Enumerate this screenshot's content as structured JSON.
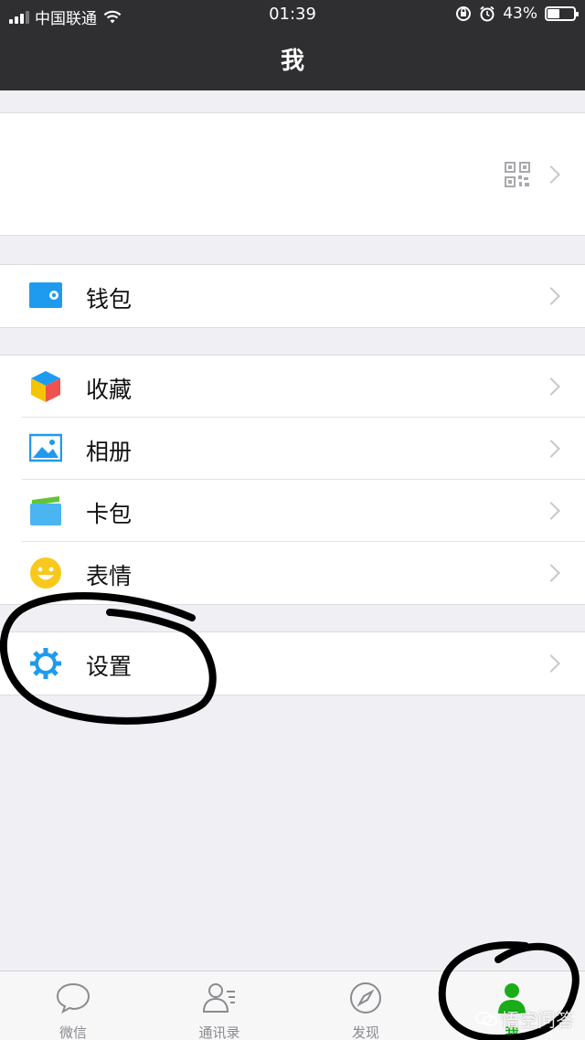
{
  "status_bar": {
    "carrier": "中国联通",
    "time": "01:39",
    "battery": "43%"
  },
  "nav": {
    "title": "我"
  },
  "menu": {
    "wallet": "钱包",
    "favorites": "收藏",
    "album": "相册",
    "cards": "卡包",
    "stickers": "表情",
    "settings": "设置"
  },
  "tabs": [
    {
      "label": "微信",
      "icon": "chat-bubble-icon"
    },
    {
      "label": "通讯录",
      "icon": "contacts-icon"
    },
    {
      "label": "发现",
      "icon": "compass-icon"
    },
    {
      "label": "我",
      "icon": "person-icon",
      "active": true
    }
  ],
  "watermark": "悟空问答",
  "colors": {
    "accent": "#1aad19",
    "blue": "#1e9bef"
  }
}
